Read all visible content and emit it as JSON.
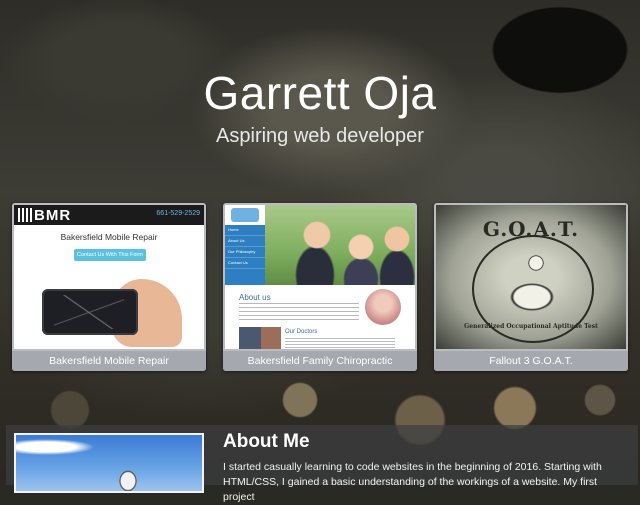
{
  "hero": {
    "name": "Garrett Oja",
    "tagline": "Aspiring web developer"
  },
  "projects": [
    {
      "caption": "Bakersfield Mobile Repair",
      "preview": {
        "logo": "BMR",
        "phone": "661-529-2529",
        "title": "Bakersfield Mobile Repair",
        "button": "Contact Us With This Form"
      }
    },
    {
      "caption": "Bakersfield Family Chiropractic",
      "preview": {
        "nav": [
          "Home",
          "About Us",
          "Our Philosophy",
          "Contact Us"
        ],
        "about_heading": "About us",
        "doctors_heading": "Our Doctors"
      }
    },
    {
      "caption": "Fallout 3 G.O.A.T.",
      "preview": {
        "title": "G.O.A.T.",
        "subtitle": "Generalized Occupational Aptitude Test"
      }
    }
  ],
  "about": {
    "heading": "About Me",
    "text": "I started casually learning to code websites in the beginning of 2016. Starting with HTML/CSS, I gained a basic understanding of the workings of a website. My first project"
  }
}
